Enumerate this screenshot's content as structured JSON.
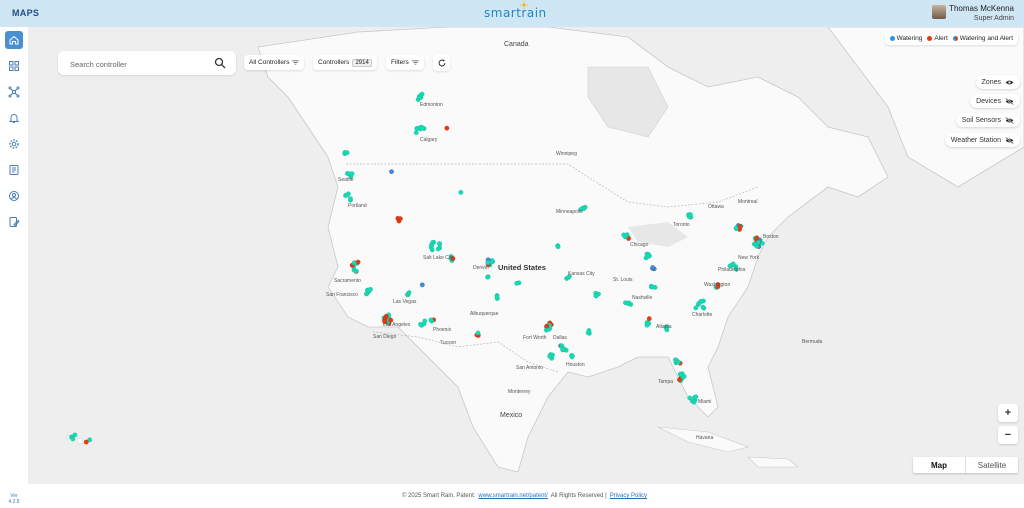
{
  "header": {
    "app_title": "MAPS",
    "logo_text": "smartrain",
    "user_name": "Thomas McKenna",
    "user_role": "Super Admin"
  },
  "sidebar": {
    "items": [
      {
        "icon": "home-icon",
        "active": true
      },
      {
        "icon": "dashboard-grid-icon",
        "active": false
      },
      {
        "icon": "network-icon",
        "active": false
      },
      {
        "icon": "bell-icon",
        "active": false
      },
      {
        "icon": "gear-icon",
        "active": false
      },
      {
        "icon": "report-icon",
        "active": false
      },
      {
        "icon": "user-settings-icon",
        "active": false
      },
      {
        "icon": "edit-document-icon",
        "active": false
      }
    ],
    "version_label": "Ver",
    "version_value": "4.2.8"
  },
  "toolbar": {
    "search_placeholder": "Search controller",
    "controller_filter": "All Controllers",
    "controllers_label": "Controllers",
    "controllers_count": "2914",
    "filters_label": "Filters"
  },
  "legend": {
    "items": [
      {
        "label": "Watering",
        "color": "#2196f3"
      },
      {
        "label": "Alert",
        "color": "#e53a12"
      },
      {
        "label": "Watering and Alert",
        "color": "split"
      }
    ]
  },
  "layers": [
    {
      "label": "Zones",
      "visible": true
    },
    {
      "label": "Devices",
      "visible": false
    },
    {
      "label": "Soil Sensors",
      "visible": false
    },
    {
      "label": "Weather Station",
      "visible": false
    }
  ],
  "map_controls": {
    "zoom_in": "+",
    "zoom_out": "−",
    "type_map": "Map",
    "type_satellite": "Satellite"
  },
  "map_labels": {
    "canada": "Canada",
    "united_states": "United States",
    "mexico": "Mexico",
    "cities": [
      "Edmonton",
      "Calgary",
      "Winnipeg",
      "Seattle",
      "Portland",
      "Salt Lake City",
      "Denver",
      "Minneapolis",
      "Chicago",
      "Toronto",
      "Ottawa",
      "Montreal",
      "Boston",
      "New York",
      "Philadelphia",
      "Washington",
      "Sacramento",
      "San Francisco",
      "Las Vegas",
      "Los Angeles",
      "San Diego",
      "Phoenix",
      "Tucson",
      "Albuquerque",
      "Fort Worth",
      "Dallas",
      "Houston",
      "San Antonio",
      "Kansas City",
      "St. Louis",
      "Atlanta",
      "Charlotte",
      "Tampa",
      "Miami",
      "Nashville",
      "Monterrey",
      "Havana",
      "Bermuda"
    ]
  },
  "footer": {
    "copyright": "© 2025 Smart Rain. Patent:",
    "patent_link": "www.smartrain.net/patent/",
    "rights": "All Rights Reserved |",
    "privacy_link": "Privacy Policy"
  }
}
